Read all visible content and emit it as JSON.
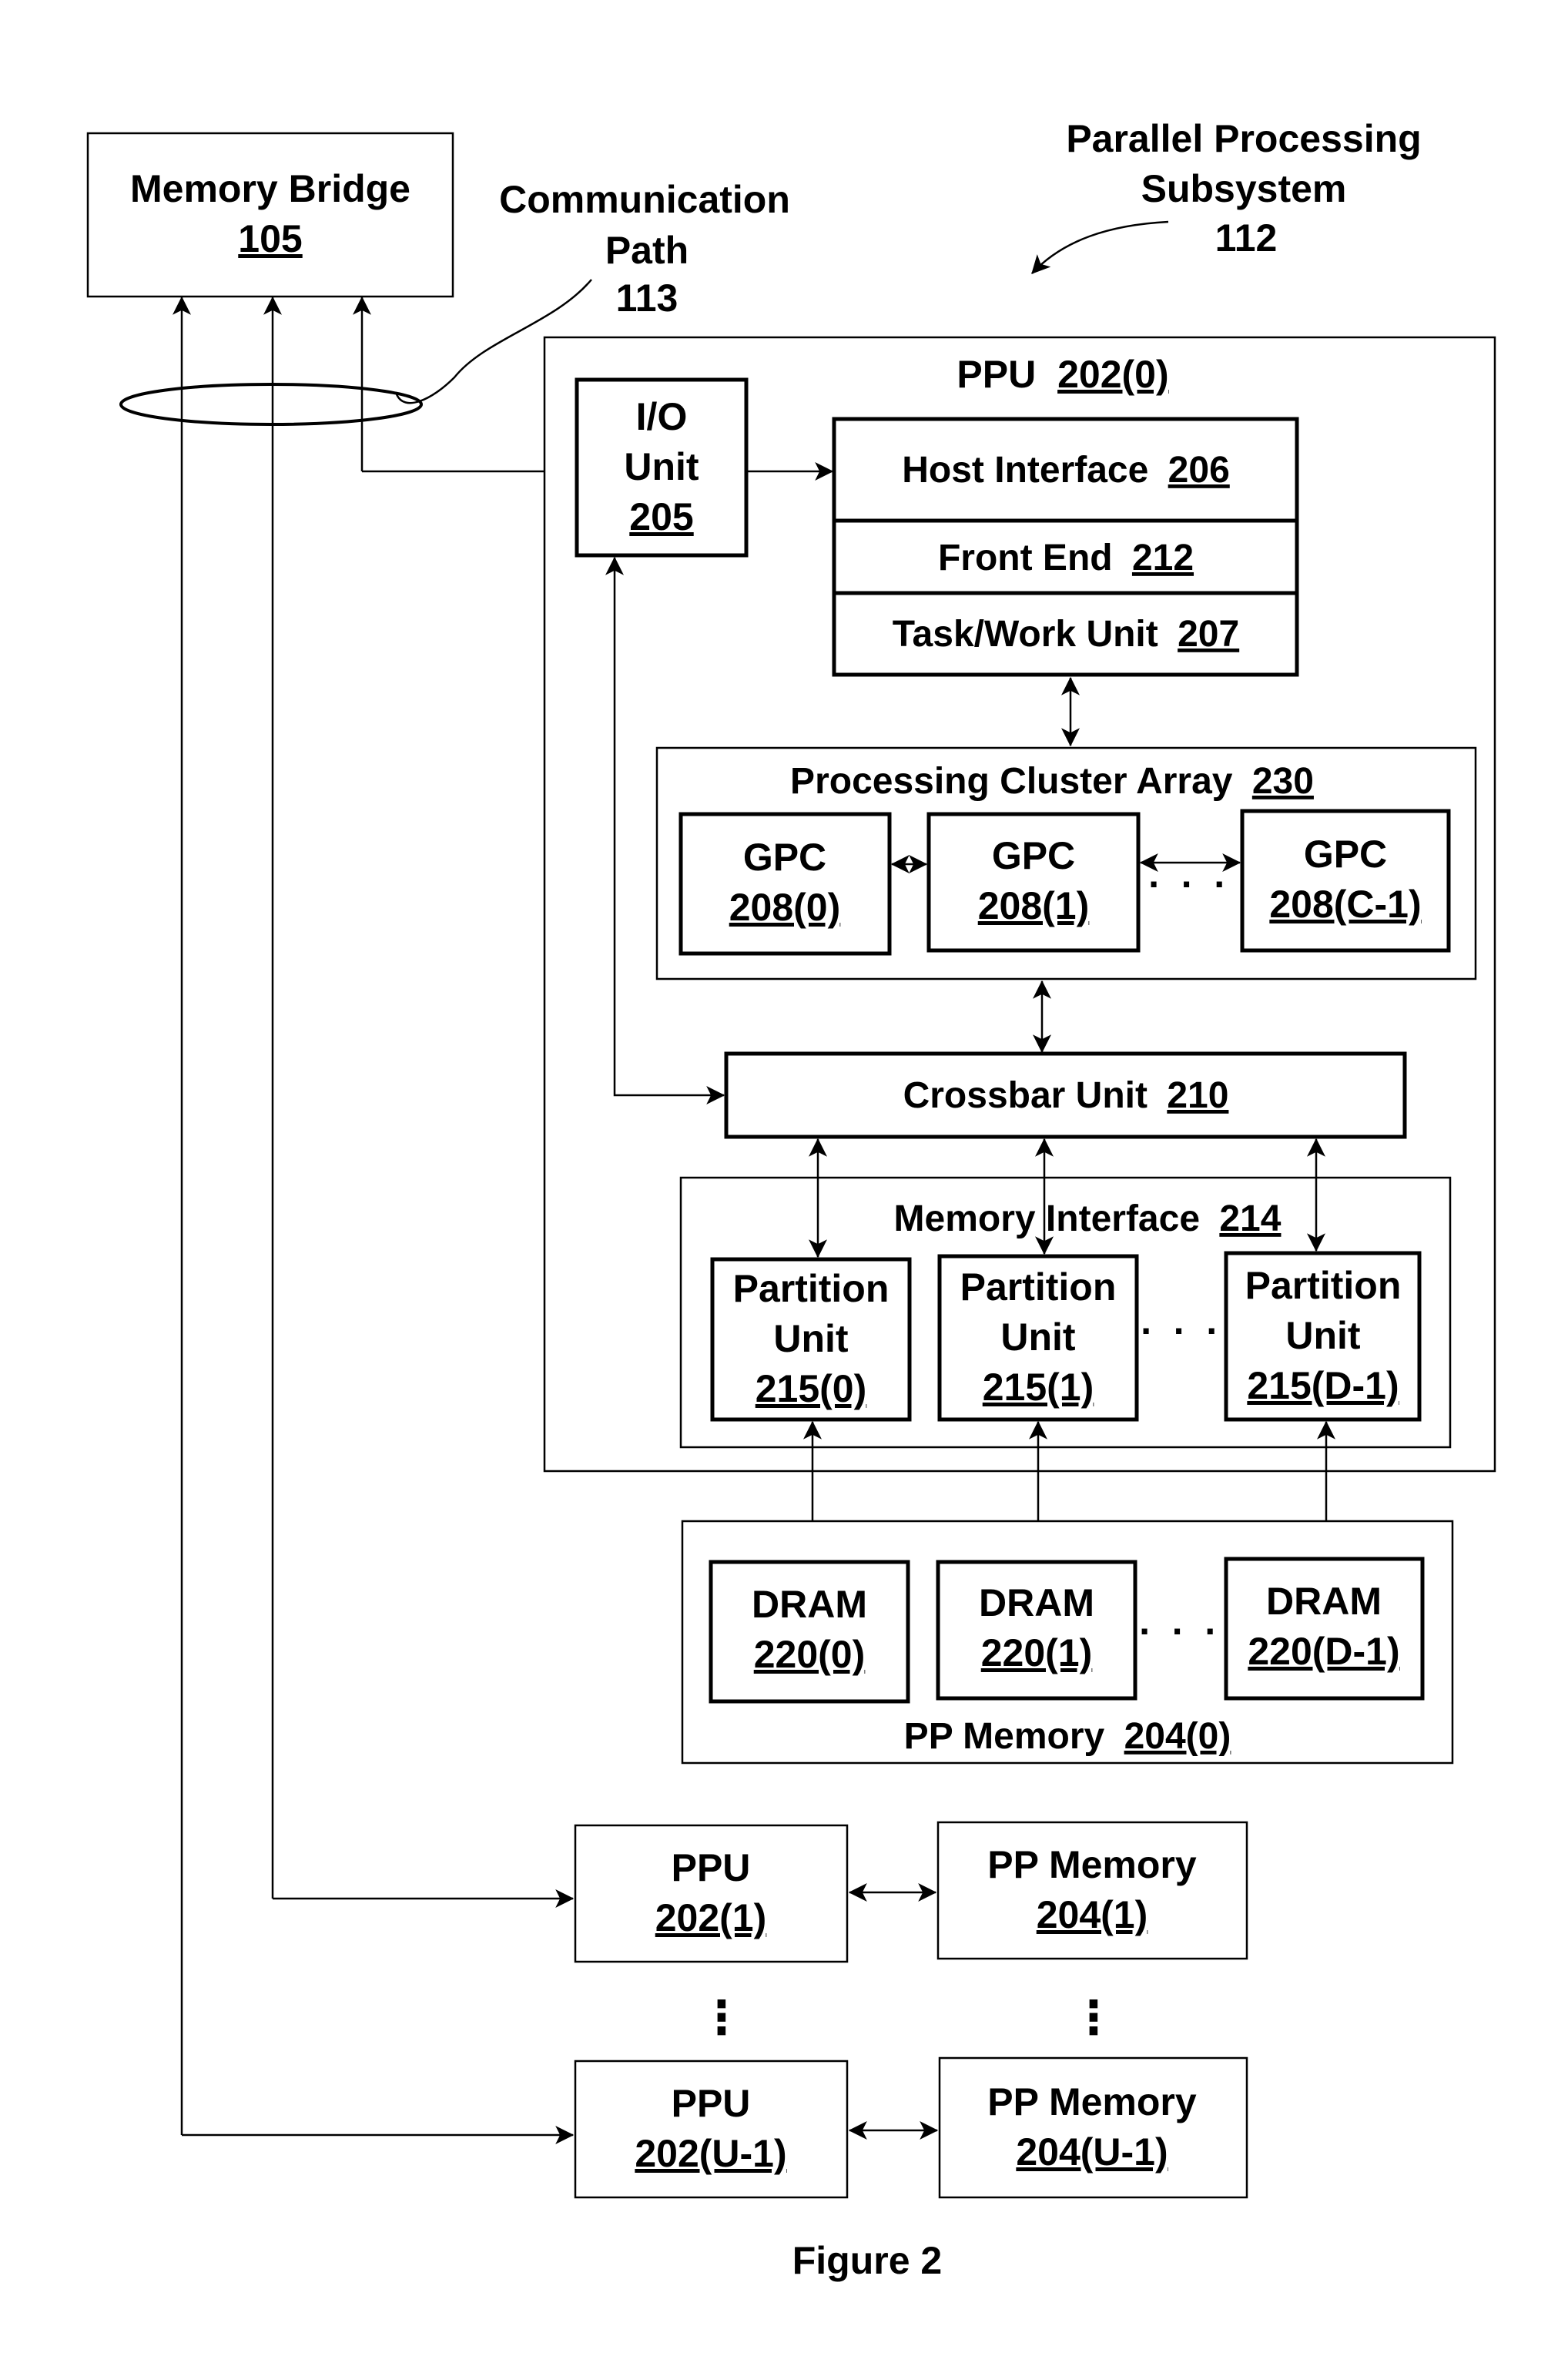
{
  "figure": {
    "caption": "Figure 2"
  },
  "labels": {
    "subsystem": {
      "line1": "Parallel Processing",
      "line2": "Subsystem",
      "ref": "112"
    },
    "comm_path": {
      "line1": "Communication",
      "line2": "Path",
      "ref": "113"
    }
  },
  "memory_bridge": {
    "name": "Memory Bridge",
    "ref": "105"
  },
  "ppu0": {
    "name": "PPU",
    "ref": "202(0)",
    "io_unit": {
      "line1": "I/O",
      "line2": "Unit",
      "ref": "205"
    },
    "host_interface": {
      "name": "Host Interface",
      "ref": "206"
    },
    "front_end": {
      "name": "Front End",
      "ref": "212"
    },
    "task_work_unit": {
      "name": "Task/Work Unit",
      "ref": "207"
    },
    "processing_cluster_array": {
      "name": "Processing Cluster Array",
      "ref": "230",
      "gpcs": [
        {
          "name": "GPC",
          "ref": "208(0)"
        },
        {
          "name": "GPC",
          "ref": "208(1)"
        },
        {
          "name": "GPC",
          "ref": "208(C-1)"
        }
      ],
      "ellipsis": "· · ·"
    },
    "crossbar": {
      "name": "Crossbar Unit",
      "ref": "210"
    },
    "memory_interface": {
      "name": "Memory Interface",
      "ref": "214",
      "partitions": [
        {
          "line1": "Partition",
          "line2": "Unit",
          "ref": "215(0)"
        },
        {
          "line1": "Partition",
          "line2": "Unit",
          "ref": "215(1)"
        },
        {
          "line1": "Partition",
          "line2": "Unit",
          "ref": "215(D-1)"
        }
      ],
      "ellipsis": "· · ·"
    }
  },
  "pp_memory0": {
    "name": "PP Memory",
    "ref": "204(0)",
    "drams": [
      {
        "name": "DRAM",
        "ref": "220(0)"
      },
      {
        "name": "DRAM",
        "ref": "220(1)"
      },
      {
        "name": "DRAM",
        "ref": "220(D-1)"
      }
    ],
    "ellipsis": "· · ·"
  },
  "other_ppus": [
    {
      "ppu_name": "PPU",
      "ppu_ref": "202(1)",
      "mem_name": "PP Memory",
      "mem_ref": "204(1)"
    },
    {
      "ppu_name": "PPU",
      "ppu_ref": "202(U-1)",
      "mem_name": "PP Memory",
      "mem_ref": "204(U-1)"
    }
  ],
  "vertical_ellipsis": "⋮"
}
